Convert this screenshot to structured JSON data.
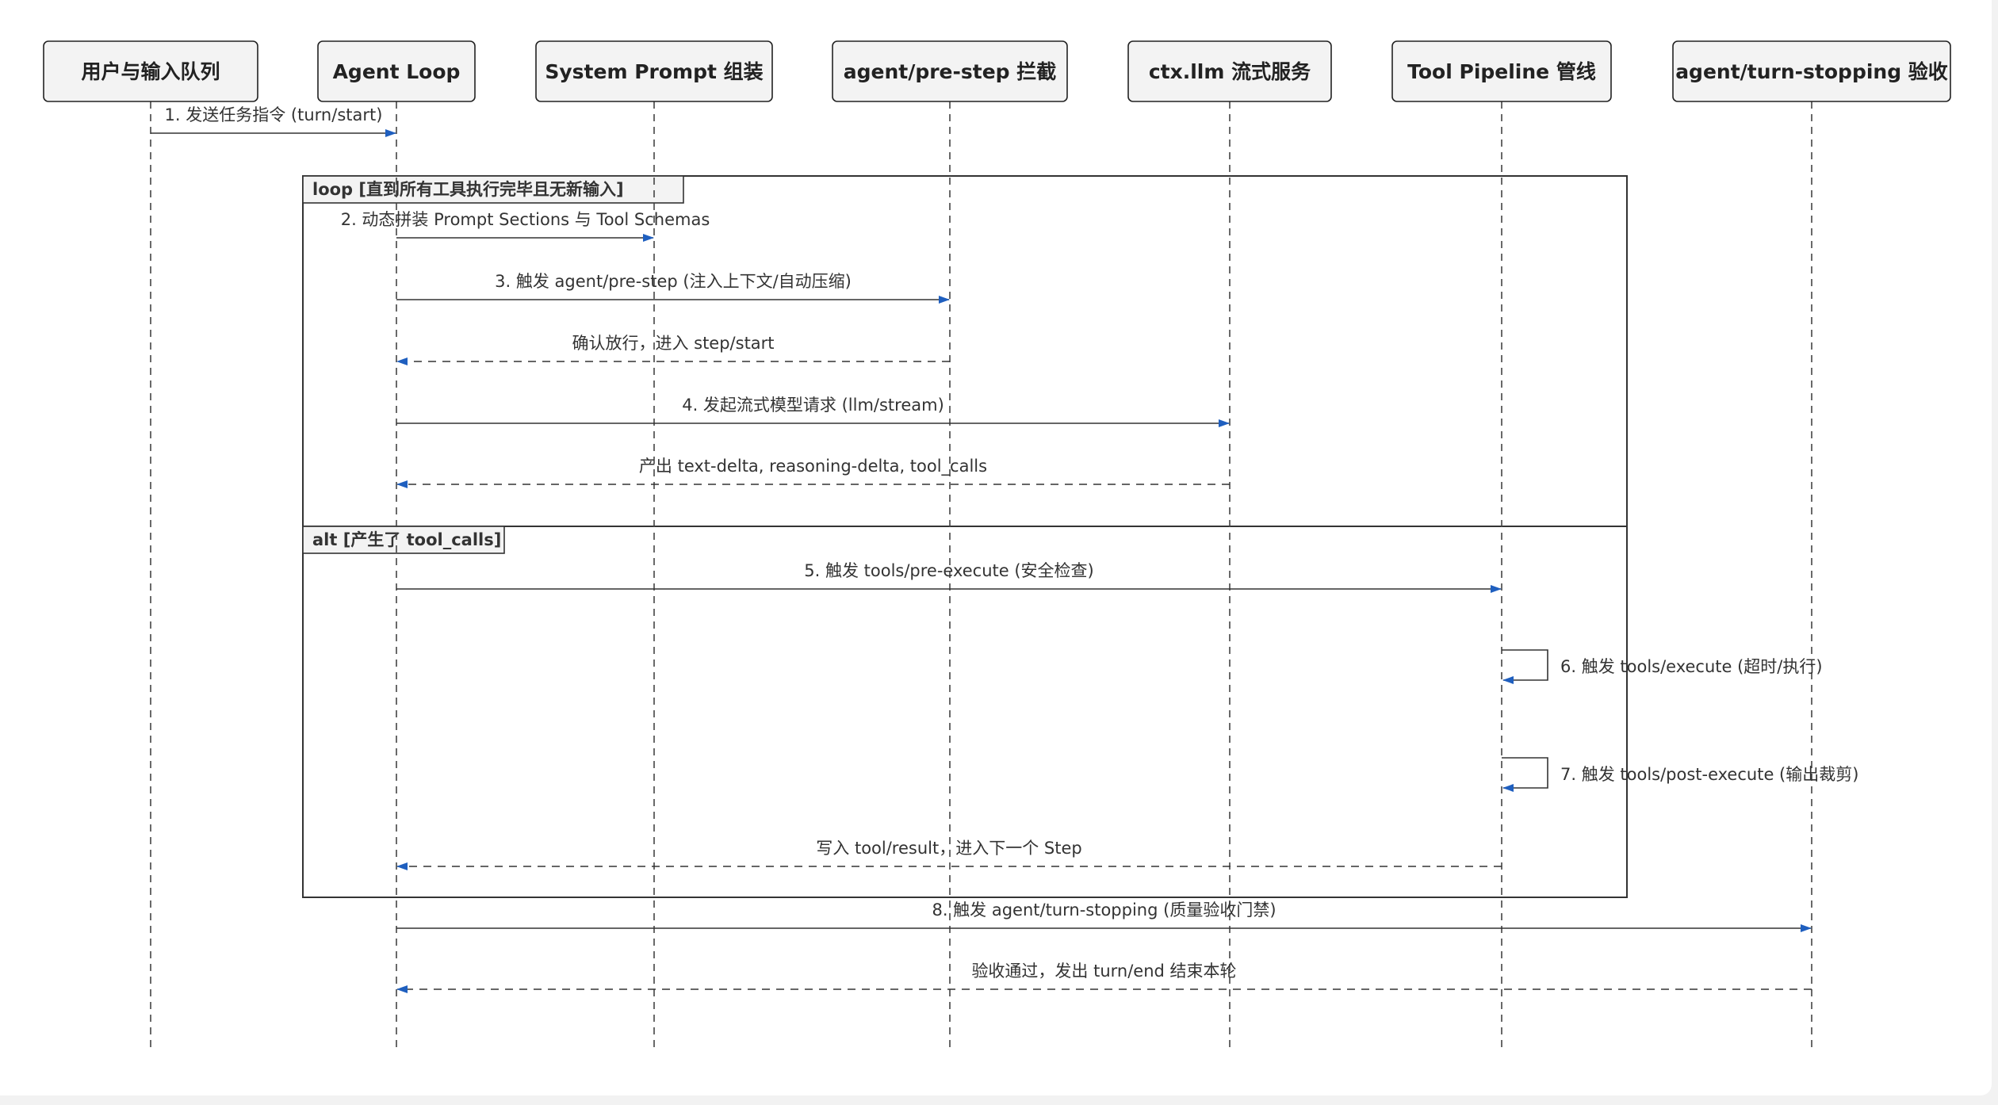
{
  "colors": {
    "arrowhead": "#1f5fbf",
    "line": "#333333",
    "participant_fill": "#f3f3f3"
  },
  "participants": [
    {
      "label": "用户与输入队列"
    },
    {
      "label": "Agent Loop"
    },
    {
      "label": "System Prompt 组装"
    },
    {
      "label": "agent/pre-step 拦截"
    },
    {
      "label": "ctx.llm 流式服务"
    },
    {
      "label": "Tool Pipeline 管线"
    },
    {
      "label": "agent/turn-stopping 验收"
    }
  ],
  "frames": [
    {
      "kind": "loop",
      "label": "loop [直到所有工具执行完毕且无新输入]"
    },
    {
      "kind": "alt",
      "label": "alt [产生了 tool_calls]"
    }
  ],
  "messages": [
    {
      "from": 0,
      "to": 1,
      "style": "solid",
      "label": "1. 发送任务指令 (turn/start)"
    },
    {
      "from": 1,
      "to": 2,
      "style": "solid",
      "label": "2. 动态拼装 Prompt Sections 与 Tool Schemas"
    },
    {
      "from": 1,
      "to": 3,
      "style": "solid",
      "label": "3. 触发 agent/pre-step (注入上下文/自动压缩)"
    },
    {
      "from": 3,
      "to": 1,
      "style": "dashed",
      "label": "确认放行，进入 step/start"
    },
    {
      "from": 1,
      "to": 4,
      "style": "solid",
      "label": "4. 发起流式模型请求 (llm/stream)"
    },
    {
      "from": 4,
      "to": 1,
      "style": "dashed",
      "label": "产出 text-delta, reasoning-delta, tool_calls"
    },
    {
      "from": 1,
      "to": 5,
      "style": "solid",
      "label": "5. 触发 tools/pre-execute (安全检查)"
    },
    {
      "from": 5,
      "to": 5,
      "style": "self",
      "label": "6. 触发 tools/execute (超时/执行)"
    },
    {
      "from": 5,
      "to": 5,
      "style": "self",
      "label": "7. 触发 tools/post-execute (输出裁剪)"
    },
    {
      "from": 5,
      "to": 1,
      "style": "dashed",
      "label": "写入 tool/result，进入下一个 Step"
    },
    {
      "from": 1,
      "to": 6,
      "style": "solid",
      "label": "8. 触发 agent/turn-stopping (质量验收门禁)"
    },
    {
      "from": 6,
      "to": 1,
      "style": "dashed",
      "label": "验收通过，发出 turn/end 结束本轮"
    }
  ]
}
